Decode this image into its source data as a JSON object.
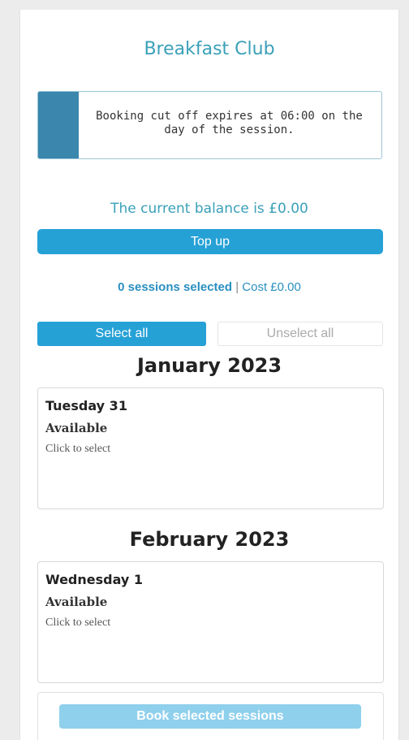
{
  "header": {
    "title": "Breakfast Club"
  },
  "notice": {
    "text": "Booking cut off expires at 06:00 on the day of the session."
  },
  "balance": {
    "text": "The current balance is £0.00"
  },
  "topup_label": "Top up",
  "summary": {
    "selected": "0 sessions selected",
    "separator": " | ",
    "cost": "Cost £0.00"
  },
  "selection": {
    "select_all": "Select all",
    "unselect_all": "Unselect all"
  },
  "months": [
    {
      "label": "January 2023",
      "sessions": [
        {
          "day": "Tuesday 31",
          "status": "Available",
          "hint": "Click to select"
        }
      ]
    },
    {
      "label": "February 2023",
      "sessions": [
        {
          "day": "Wednesday 1",
          "status": "Available",
          "hint": "Click to select"
        }
      ]
    }
  ],
  "book_label": "Book selected sessions",
  "colors": {
    "accent": "#26a1d6",
    "title": "#3aa0b8",
    "notice_bar": "#3a86ad",
    "disabled": "#8fd0ec"
  }
}
